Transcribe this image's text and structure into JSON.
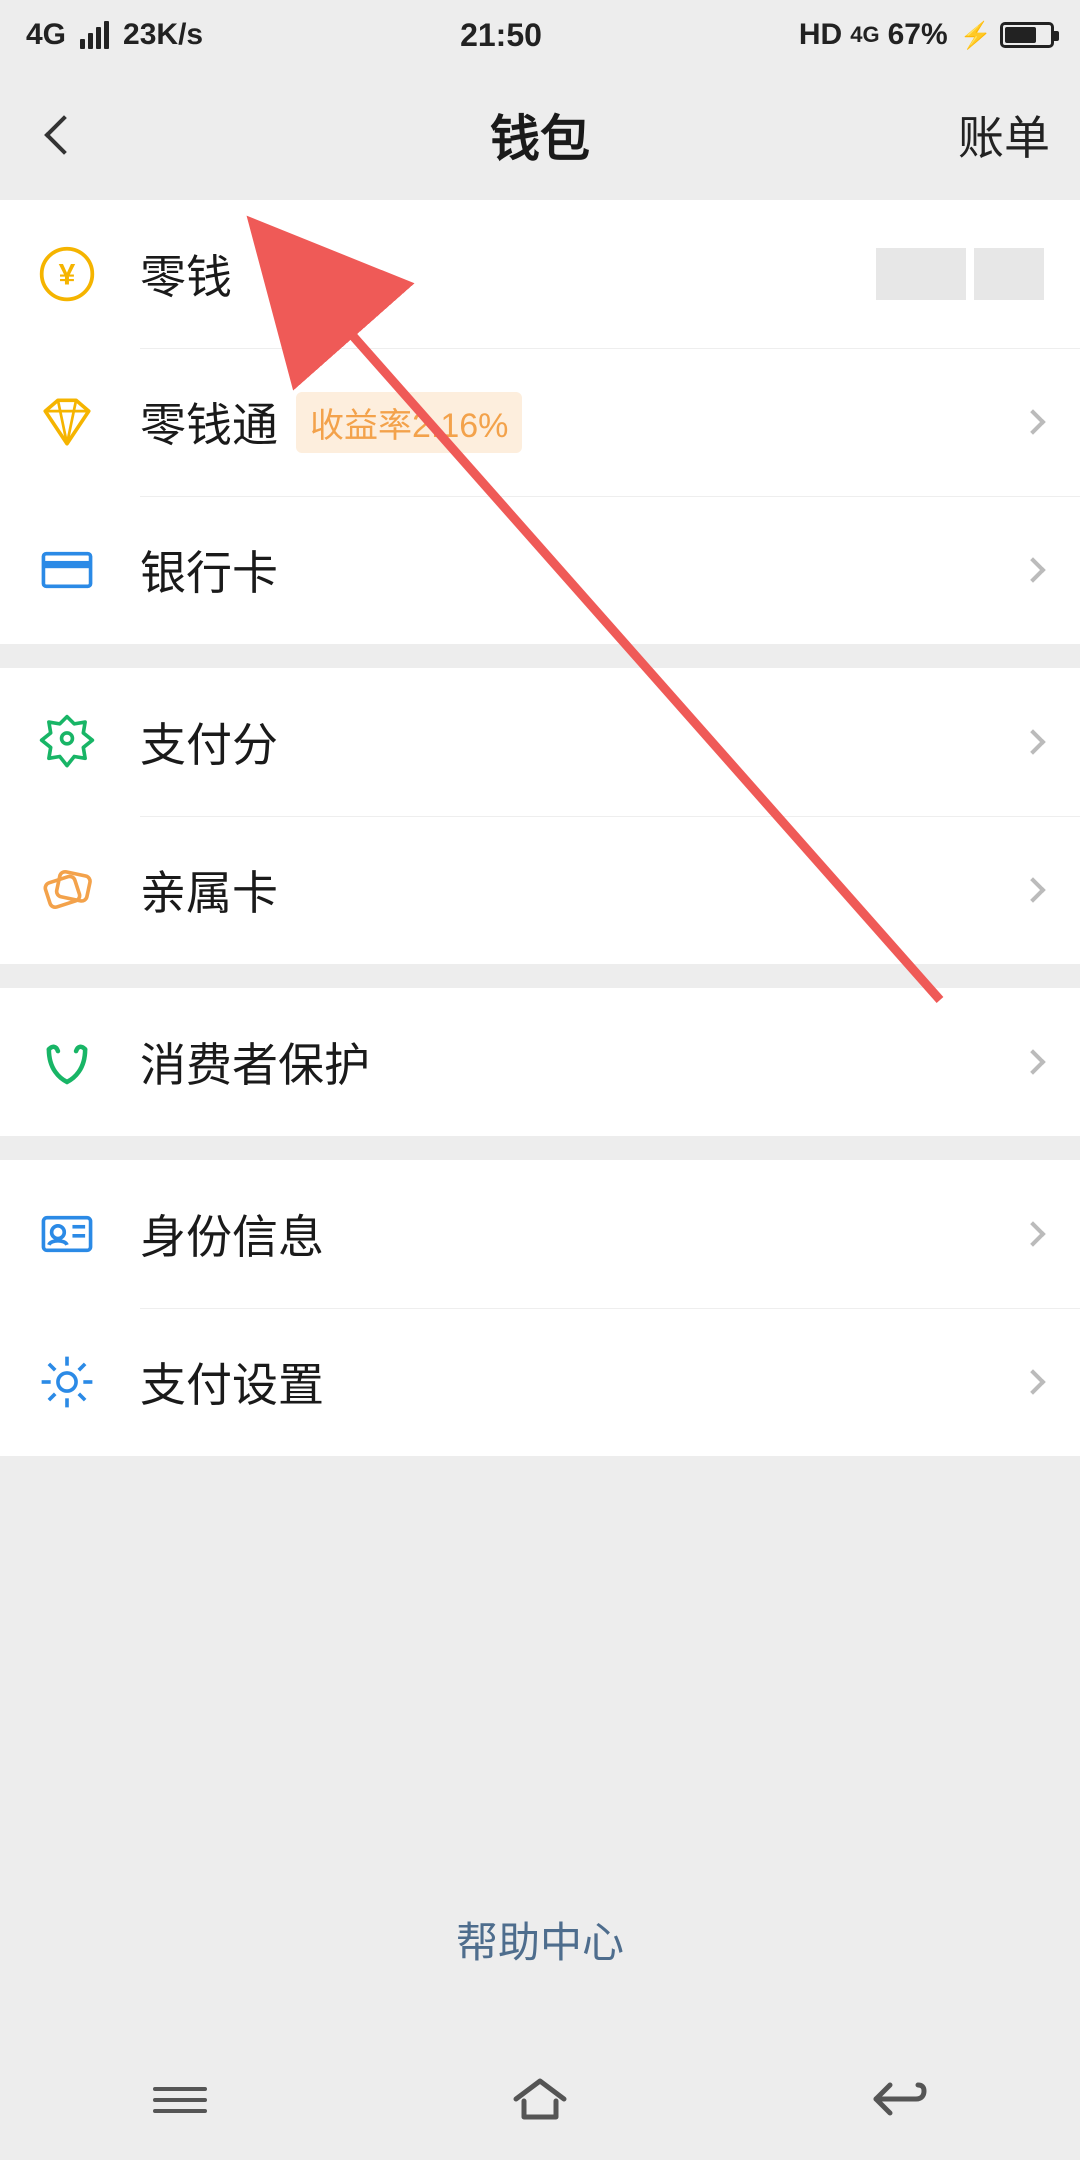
{
  "status": {
    "network": "4G",
    "speed": "23K/s",
    "time": "21:50",
    "hd": "HD",
    "net2": "4G",
    "battery_pct": "67%"
  },
  "nav": {
    "title": "钱包",
    "right": "账单"
  },
  "rows": {
    "balance": {
      "label": "零钱"
    },
    "lqt": {
      "label": "零钱通",
      "badge": "收益率2.16%"
    },
    "bank": {
      "label": "银行卡"
    },
    "payscore": {
      "label": "支付分"
    },
    "family": {
      "label": "亲属卡"
    },
    "consumer": {
      "label": "消费者保护"
    },
    "identity": {
      "label": "身份信息"
    },
    "settings": {
      "label": "支付设置"
    }
  },
  "footer": {
    "help": "帮助中心"
  },
  "colors": {
    "yellow": "#f5b400",
    "orange": "#f3a24b",
    "blue": "#2b8ae6",
    "green": "#18b566",
    "link": "#4e6d8d",
    "arrow": "#ef5a57"
  }
}
